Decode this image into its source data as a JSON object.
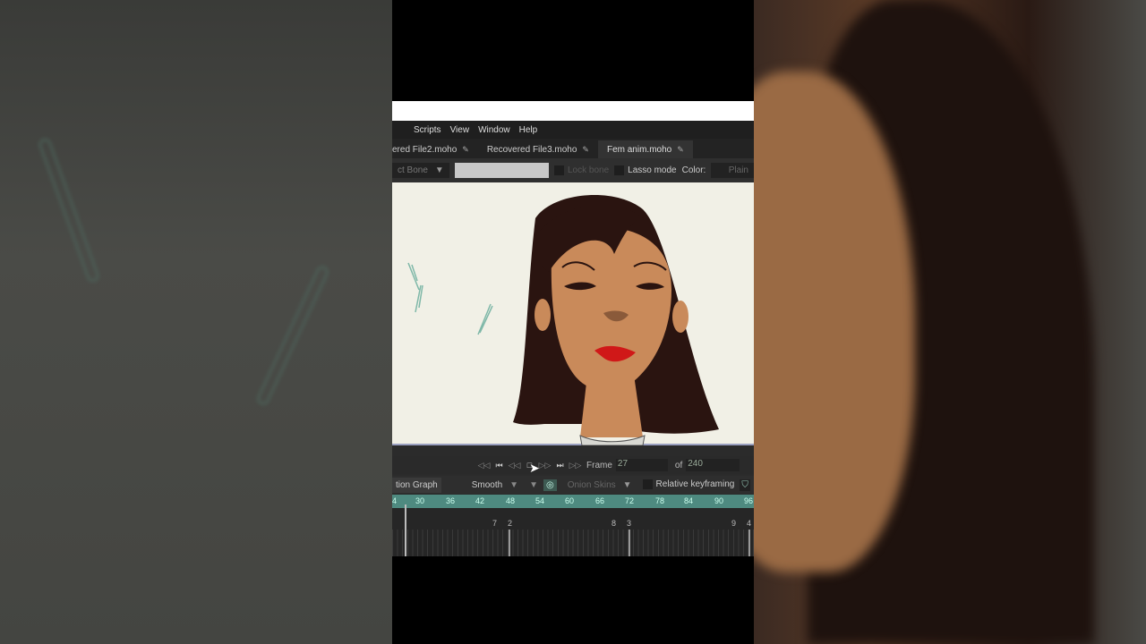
{
  "menu": [
    "Scripts",
    "View",
    "Window",
    "Help"
  ],
  "tabs": [
    {
      "label": "ered File2.moho"
    },
    {
      "label": "Recovered File3.moho"
    },
    {
      "label": "Fem anim.moho",
      "active": true
    }
  ],
  "toolbar": {
    "bone_select": "ct Bone",
    "lock_bone": "Lock bone",
    "lasso_mode": "Lasso mode",
    "color_label": "Color:",
    "color_value": "Plain"
  },
  "playback": {
    "frame_label": "Frame",
    "frame": "27",
    "of_label": "of",
    "total": "240"
  },
  "options": {
    "graph": "tion Graph",
    "interp": "Smooth",
    "onion": "Onion Skins",
    "relative": "Relative keyframing"
  },
  "ruler": [
    "4",
    "30",
    "36",
    "42",
    "48",
    "54",
    "60",
    "66",
    "72",
    "78",
    "84",
    "90",
    "96"
  ],
  "keyframes": [
    "7",
    "2",
    "8",
    "3",
    "9",
    "4"
  ],
  "colors": {
    "ruler": "#4e8a80",
    "canvas": "#f1f0e6",
    "skin": "#c98a5a",
    "hair": "#2a1410",
    "lips": "#d01818"
  }
}
